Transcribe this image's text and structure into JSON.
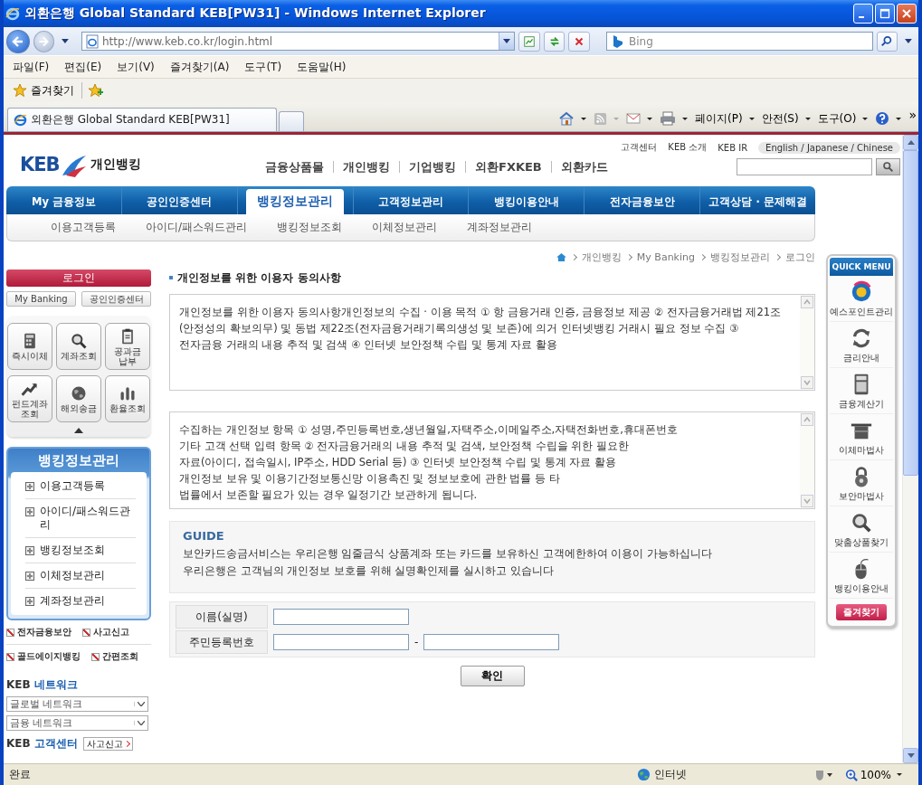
{
  "window": {
    "title": "외환은행 Global Standard KEB[PW31] - Windows Internet Explorer"
  },
  "address_bar": {
    "url": "http://www.keb.co.kr/login.html"
  },
  "search_box": {
    "placeholder": "Bing"
  },
  "menu_bar": [
    "파일(F)",
    "편집(E)",
    "보기(V)",
    "즐겨찾기(A)",
    "도구(T)",
    "도움말(H)"
  ],
  "favorites_bar": {
    "label": "즐겨찾기"
  },
  "tabs": [
    {
      "label": "외환은행 Global Standard KEB[PW31]",
      "selected": true
    }
  ],
  "command_bar": {
    "items": [
      "페이지(P)",
      "안전(S)",
      "도구(O)"
    ],
    "overflow": "»"
  },
  "page": {
    "top_links": [
      "고객센터",
      "KEB 소개",
      "KEB IR"
    ],
    "language": "English / Japanese / Chinese",
    "logo": {
      "brand": "KEB",
      "section": "개인뱅킹"
    },
    "main_links": [
      "금융상품몰",
      "개인뱅킹",
      "기업뱅킹",
      "외환FXKEB",
      "외환카드"
    ],
    "nav_tabs": [
      {
        "label": "My 금융정보",
        "selected": false
      },
      {
        "label": "공인인증센터",
        "selected": false
      },
      {
        "label": "뱅킹정보관리",
        "selected": true
      },
      {
        "label": "고객정보관리",
        "selected": false
      },
      {
        "label": "뱅킹이용안내",
        "selected": false
      },
      {
        "label": "전자금융보안",
        "selected": false
      },
      {
        "label": "고객상담 · 문제해결",
        "selected": false
      }
    ],
    "sub_nav": [
      "이용고객등록",
      "아이디/패스워드관리",
      "뱅킹정보조회",
      "이체정보관리",
      "계좌정보관리"
    ],
    "breadcrumb": [
      "개인뱅킹",
      "My Banking",
      "뱅킹정보관리",
      "로그인"
    ],
    "sidebar": {
      "login_button": "로그인",
      "buttons": [
        "My Banking",
        "공인인증센터"
      ],
      "shortcuts": [
        "즉시이체",
        "계좌조회",
        "공과금 납부",
        "펀드계좌 조회",
        "해외송금",
        "환율조회"
      ],
      "menu_title": "뱅킹정보관리",
      "menu_items": [
        "이용고객등록",
        "아이디/패스워드관리",
        "뱅킹정보조회",
        "이체정보관리",
        "계좌정보관리"
      ],
      "links": [
        "전자금융보안",
        "사고신고",
        "골드에이지뱅킹",
        "간편조회"
      ],
      "network": {
        "brand": "KEB",
        "label": "네트워크"
      },
      "selects": [
        "글로벌 네트워크",
        "금융 네트워크"
      ],
      "customer_center": {
        "brand": "KEB",
        "label": "고객센터",
        "button": "사고신고"
      }
    },
    "section_title": "개인정보를 위한 이용자 동의사항",
    "consent_boxes": [
      {
        "lines": [
          "개인정보를 위한 이용자 동의사항개인정보의 수집 · 이용 목적 ① 항 금융거래 인증, 금융정보 제공 ② 전자금융거래법 제21조",
          "(안정성의 확보의무) 및 동법 제22조(전자금융거래기록의생성 및 보존)에 의거 인터넷뱅킹 거래시 필요 정보 수집 ③",
          "전자금융 거래의 내용 추적 및 검색 ④ 인터넷 보안정책 수립 및 통계 자료 활용"
        ]
      },
      {
        "lines": [
          "수집하는 개인정보 항목 ① 성명,주민등록번호,생년월일,자택주소,이메일주소,자택전화번호,휴대폰번호",
          "기타 고객 선택 입력 항목 ② 전자금융거래의 내용 추적 및 검색, 보안정책 수립을 위한 필요한",
          "자료(아이디, 접속일시, IP주소, HDD Serial 등) ③ 인터넷 보안정책 수립 및 통계 자료 활용",
          "개인정보 보유 및 이용기간정보통신망 이용촉진 및 정보보호에 관한 법률 등 타",
          "법률에서 보존할 필요가 있는 경우 일정기간 보관하게 됩니다."
        ]
      }
    ],
    "guide": {
      "title": "GUIDE",
      "lines": [
        "보안카드송금서비스는 우리은행 임줄금식 상품계좌 또는 카드를 보유하신 고객에한하여 이용이 가능하십니다",
        "우리은행은 고객님의 개인정보 보호를 위해 실명확인제를 실시하고 있습니다"
      ]
    },
    "form": {
      "fields": [
        {
          "label": "이름(실명)",
          "kind": "single"
        },
        {
          "label": "주민등록번호",
          "kind": "split"
        }
      ],
      "separator": "-",
      "submit": "확인"
    },
    "quick_menu": {
      "title": "QUICK MENU",
      "items": [
        "예스포인트관리",
        "금리안내",
        "금융계산기",
        "이체마법사",
        "보안마법사",
        "맞춤상품찾기",
        "뱅킹이용안내"
      ],
      "bookmark": "즐겨찾기"
    }
  },
  "status_bar": {
    "text": "완료",
    "zone": "인터넷",
    "zoom": "100%"
  }
}
